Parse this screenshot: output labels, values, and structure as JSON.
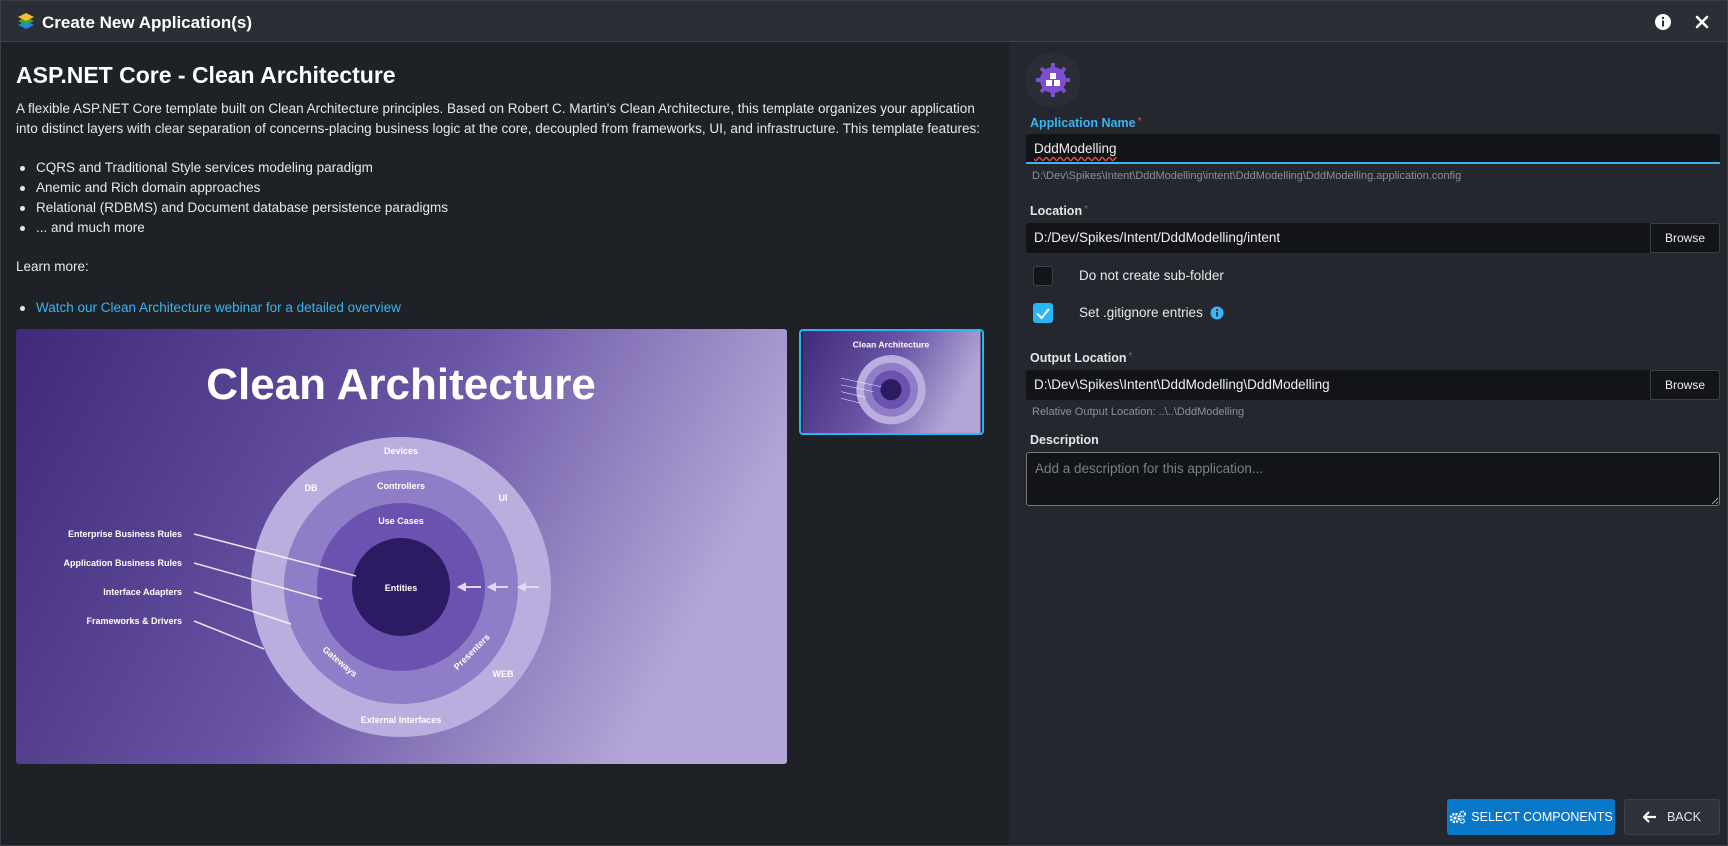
{
  "window": {
    "title": "Create New Application(s)",
    "info_icon": "info-circle-icon",
    "close_icon": "close-icon"
  },
  "template": {
    "title": "ASP.NET Core - Clean Architecture",
    "description": "A flexible ASP.NET Core template built on Clean Architecture principles. Based on Robert C. Martin's Clean Architecture, this template organizes your application into distinct layers with clear separation of concerns-placing business logic at the core, decoupled from frameworks, UI, and infrastructure. This template features:",
    "features": [
      "CQRS and Traditional Style services modeling paradigm",
      "Anemic and Rich domain approaches",
      "Relational (RDBMS) and Document database persistence paradigms",
      "... and much more"
    ],
    "learn_more_label": "Learn more:",
    "links": [
      "Watch our Clean Architecture webinar for a detailed overview"
    ]
  },
  "diagram": {
    "title": "Clean Architecture",
    "ring_labels": {
      "devices": "Devices",
      "controllers": "Controllers",
      "use_cases": "Use Cases",
      "entities": "Entities",
      "db": "DB",
      "ui": "UI",
      "gateways": "Gateways",
      "presenters": "Presenters",
      "web": "WEB",
      "external_interfaces": "External Interfaces"
    },
    "legend": [
      "Enterprise Business Rules",
      "Application Business Rules",
      "Interface Adapters",
      "Frameworks & Drivers"
    ],
    "thumbnail_title": "Clean Architecture"
  },
  "form": {
    "app_name_label": "Application Name",
    "app_name_value": "DddModelling",
    "config_path": "D:\\Dev\\Spikes\\Intent\\DddModelling\\intent\\DddModelling\\DddModelling.application.config",
    "location_label": "Location",
    "location_value": "D:/Dev/Spikes/Intent/DddModelling/intent",
    "browse_label": "Browse",
    "no_subfolder_label": "Do not create sub-folder",
    "no_subfolder_checked": false,
    "gitignore_label": "Set .gitignore entries",
    "gitignore_checked": true,
    "output_label": "Output Location",
    "output_value": "D:\\Dev\\Spikes\\Intent\\DddModelling\\DddModelling",
    "relative_output": "Relative Output Location: ..\\..\\DddModelling",
    "description_label": "Description",
    "description_placeholder": "Add a description for this application...",
    "required_mark": "*"
  },
  "actions": {
    "select_components": "SELECT COMPONENTS",
    "back": "BACK"
  },
  "colors": {
    "accent": "#3ab4f2",
    "primary_button": "#0a78c8",
    "checkbox_on": "#29b6f6",
    "diagram_bg_dark": "#3e2a78",
    "diagram_bg_light": "#b3a6d6"
  }
}
